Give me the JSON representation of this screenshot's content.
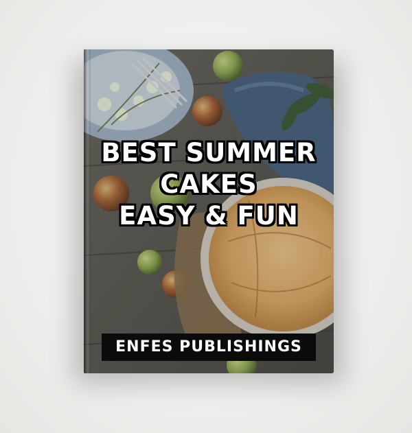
{
  "cover": {
    "title_line1": "BEST SUMMER",
    "title_line2": "CAKES",
    "title_line3": "EASY & FUN",
    "publisher": "ENFES PUBLISHINGS"
  },
  "colors": {
    "background": "#f1f1ef",
    "title_text": "#ffffff",
    "title_outline": "#000000",
    "publisher_bg": "#0b0b0b",
    "publisher_text": "#ffffff"
  }
}
